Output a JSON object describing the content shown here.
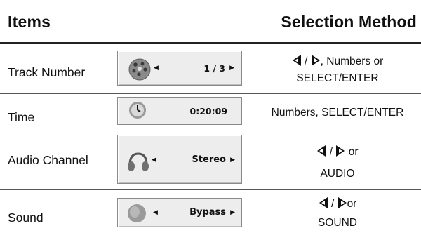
{
  "header": {
    "items": "Items",
    "selection_method": "Selection Method"
  },
  "rows": [
    {
      "label": "Track Number",
      "display_value": "1 / 3",
      "icon": "disc-icon",
      "method_line1_suffix": ", Numbers or",
      "method_line2": "SELECT/ENTER"
    },
    {
      "label": "Time",
      "display_value": "0:20:09",
      "icon": "clock-icon",
      "method_line1": "Numbers, SELECT/ENTER"
    },
    {
      "label": "Audio Channel",
      "display_value": "Stereo",
      "icon": "headphones-icon",
      "method_line1_suffix": " or",
      "method_line2": "AUDIO"
    },
    {
      "label": "Sound",
      "display_value": "Bypass",
      "icon": "sound-icon",
      "method_line1_suffix": "or",
      "method_line2": "SOUND"
    }
  ],
  "method_separator": "/"
}
